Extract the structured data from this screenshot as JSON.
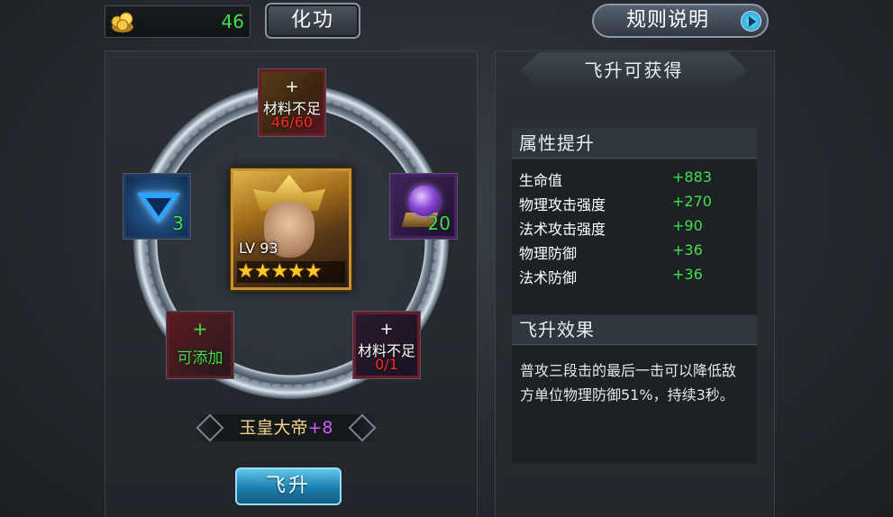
{
  "currency": {
    "icon": "gold-coin-icon",
    "value": "46"
  },
  "buttons": {
    "dissolve": "化功",
    "rules": "规则说明",
    "ascend": "飞升"
  },
  "slots": {
    "top": {
      "plus": "+",
      "label": "材料不足",
      "count": "46/60"
    },
    "left": {
      "icon": "blue-triangle-gem-icon",
      "count": "3"
    },
    "right": {
      "icon": "purple-orb-icon",
      "count": "20"
    },
    "bottom_left": {
      "plus": "+",
      "label": "可添加"
    },
    "bottom_right": {
      "plus": "+",
      "label": "材料不足",
      "count": "0/1"
    }
  },
  "hero": {
    "level": "LV 93",
    "stars": "★★★★★",
    "name": "玉皇大帝",
    "plus": "+8"
  },
  "rewards": {
    "title": "飞升可获得",
    "attributes_header": "属性提升",
    "attributes": [
      {
        "name": "生命值",
        "value": "+883"
      },
      {
        "name": "物理攻击强度",
        "value": "+270"
      },
      {
        "name": "法术攻击强度",
        "value": "+90"
      },
      {
        "name": "物理防御",
        "value": "+36"
      },
      {
        "name": "法术防御",
        "value": "+36"
      }
    ],
    "effect_header": "飞升效果",
    "effect_text": "普攻三段击的最后一击可以降低敌方单位物理防御51%，持续3秒。"
  },
  "colors": {
    "green": "#3fe04a",
    "red": "#ff2a2a",
    "gold": "#f3d28a",
    "purple": "#d05cff",
    "accent_blue": "#1c7fae"
  }
}
